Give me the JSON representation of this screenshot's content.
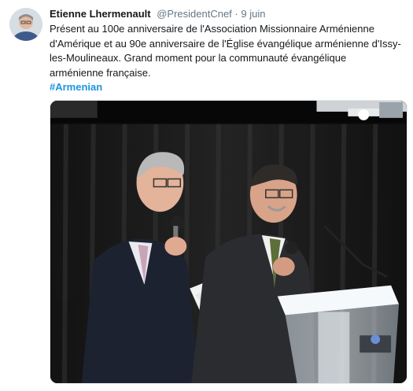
{
  "tweet": {
    "author_name": "Etienne Lhermenault",
    "handle": "@PresidentCnef",
    "separator": "·",
    "date": "9 juin",
    "text_lines": [
      "Présent au 100e anniversaire de l'Association Missionnaire Arménienne",
      "d'Amérique et au 90e anniversaire de l'Église évangélique arménienne d'Issy-",
      "les-Moulineaux. Grand moment pour la communauté évangélique",
      "arménienne française."
    ],
    "hashtag": "#Armenian"
  },
  "colors": {
    "link": "#1b95e0",
    "muted": "#657786",
    "text": "#14171a"
  },
  "icons": {
    "avatar": "avatar-photo"
  }
}
